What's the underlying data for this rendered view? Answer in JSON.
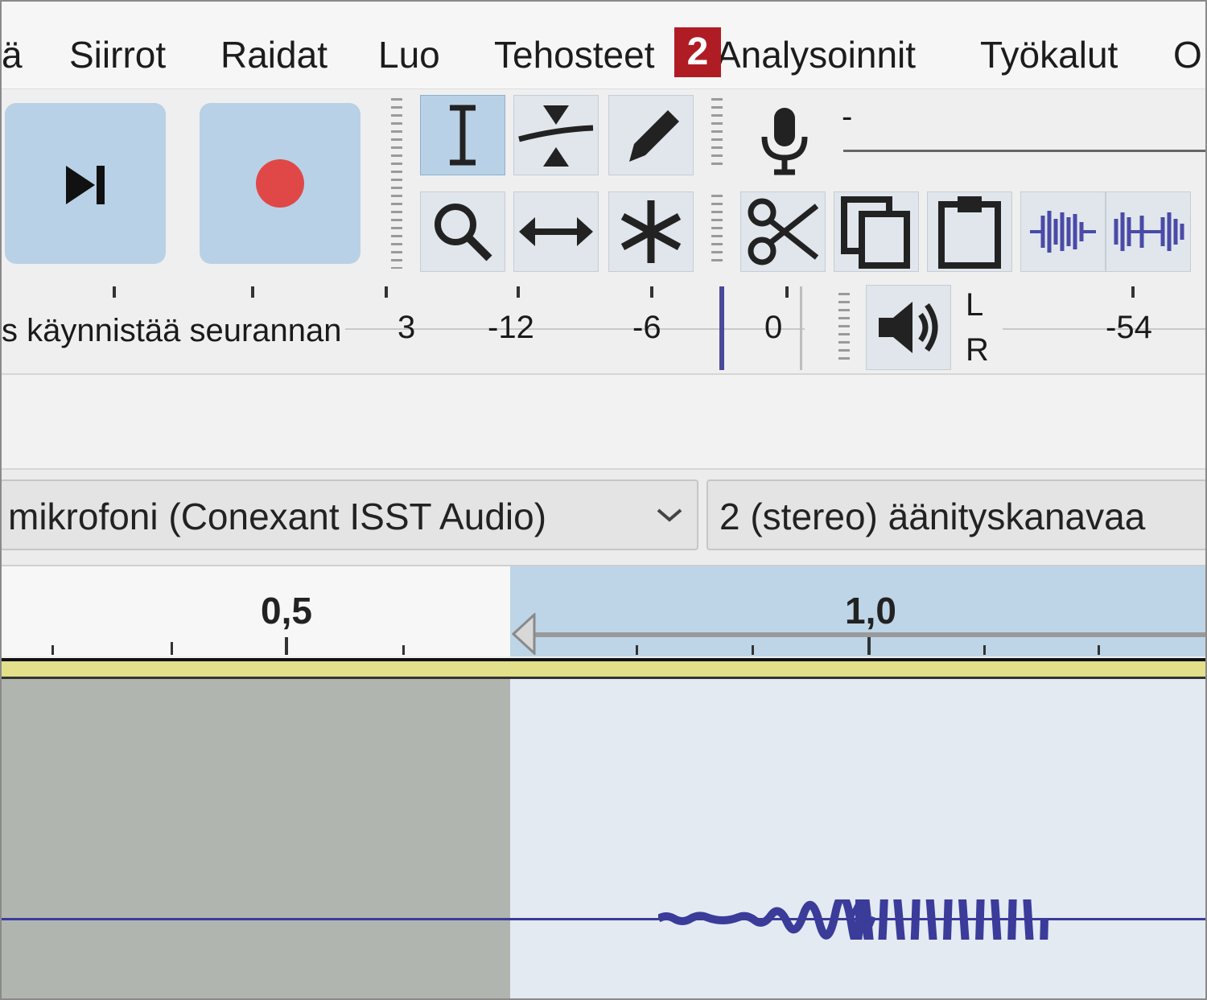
{
  "menu": {
    "items": [
      {
        "label": "ä"
      },
      {
        "label": "Siirrot"
      },
      {
        "label": "Raidat"
      },
      {
        "label": "Luo"
      },
      {
        "label": "Tehosteet"
      },
      {
        "label": "Analysoinnit"
      },
      {
        "label": "Työkalut"
      },
      {
        "label": "O"
      }
    ],
    "badge": "2"
  },
  "transport": {
    "skip_end_icon": "skip-to-end-icon",
    "record_icon": "record-icon",
    "record_color": "#e04848"
  },
  "tools": {
    "top": [
      "selection-tool-icon",
      "envelope-tool-icon",
      "draw-tool-icon"
    ],
    "bottom": [
      "zoom-tool-icon",
      "timeshift-tool-icon",
      "multi-tool-icon"
    ],
    "edit": [
      "cut-icon",
      "copy-icon",
      "paste-icon",
      "trim-icon",
      "silence-icon"
    ]
  },
  "recording_meter": {
    "label": "s käynnistää seurannan",
    "ticks": [
      "3",
      "-12",
      "-6",
      "0"
    ],
    "dash": "-"
  },
  "playback_meter": {
    "L": "L",
    "R": "R",
    "ticks": [
      "-54"
    ]
  },
  "devices": {
    "input_device": "mikrofoni (Conexant ISST Audio)",
    "channels": "2 (stereo) äänityskanavaa"
  },
  "timeline": {
    "labels": [
      "0,5",
      "1,0"
    ]
  },
  "colors": {
    "accent_blue": "#b9d1e6",
    "selection": "#e3eaf2",
    "waveform": "#3b3b9a",
    "badge": "#b01c24"
  }
}
